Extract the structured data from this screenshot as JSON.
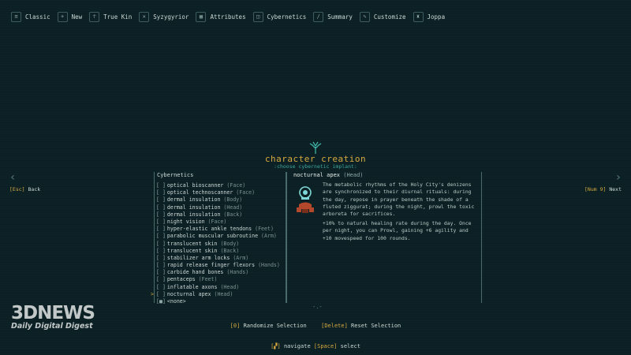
{
  "topbar": {
    "tabs": [
      {
        "label": "Classic",
        "icon": "scroll-icon"
      },
      {
        "label": "New",
        "icon": "plus-icon"
      },
      {
        "label": "True Kin",
        "icon": "person-icon"
      },
      {
        "label": "Syzygyrior",
        "icon": "crossed-swords-icon"
      },
      {
        "label": "Attributes",
        "icon": "attributes-icon"
      },
      {
        "label": "Cybernetics",
        "icon": "chip-icon"
      },
      {
        "label": "Summary",
        "icon": "page-icon"
      },
      {
        "label": "Customize",
        "icon": "pen-icon"
      },
      {
        "label": "Joppa",
        "icon": "walker-icon"
      }
    ]
  },
  "header": {
    "title": "character creation",
    "subtitle": ":choose cybernetic implant:"
  },
  "nav": {
    "back_key": "[Esc]",
    "back_label": "Back",
    "next_key": "[Num 9]",
    "next_label": "Next"
  },
  "list": {
    "title": "Cybernetics",
    "items": [
      {
        "checkbox": "[ ]",
        "name": "optical bioscanner",
        "slot": "(Face)"
      },
      {
        "checkbox": "[ ]",
        "name": "optical technoscanner",
        "slot": "(Face)"
      },
      {
        "checkbox": "[ ]",
        "name": "dermal insulation",
        "slot": "(Body)"
      },
      {
        "checkbox": "[ ]",
        "name": "dermal insulation",
        "slot": "(Head)"
      },
      {
        "checkbox": "[ ]",
        "name": "dermal insulation",
        "slot": "(Back)"
      },
      {
        "checkbox": "[ ]",
        "name": "night vision",
        "slot": "(Face)"
      },
      {
        "checkbox": "[ ]",
        "name": "hyper-elastic ankle tendons",
        "slot": "(Feet)"
      },
      {
        "checkbox": "[ ]",
        "name": "parabolic muscular subroutine",
        "slot": "(Arm)"
      },
      {
        "checkbox": "[ ]",
        "name": "translucent skin",
        "slot": "(Body)"
      },
      {
        "checkbox": "[ ]",
        "name": "translucent skin",
        "slot": "(Back)"
      },
      {
        "checkbox": "[ ]",
        "name": "stabilizer arm locks",
        "slot": "(Arm)"
      },
      {
        "checkbox": "[ ]",
        "name": "rapid release finger flexors",
        "slot": "(Hands)"
      },
      {
        "checkbox": "[ ]",
        "name": "carbide hand bones",
        "slot": "(Hands)"
      },
      {
        "checkbox": "[ ]",
        "name": "pentaceps",
        "slot": "(Feet)"
      },
      {
        "checkbox": "[ ]",
        "name": "inflatable axons",
        "slot": "(Head)"
      },
      {
        "checkbox": "[ ]",
        "name": "nocturnal apex",
        "slot": "(Head)",
        "caret": ">"
      },
      {
        "checkbox": "[■]",
        "name": "<none>",
        "slot": ""
      }
    ]
  },
  "detail": {
    "name": "nocturnal apex",
    "slot": "(Head)",
    "description": "The metabolic rhythms of the Holy City's denizens are synchronized to their diurnal rituals: during the day, repose in prayer beneath the shade of a fluted ziggurat; during the night, prowl the toxic arboreta for sacrifices.",
    "effect": "+10% to natural healing rate during the day. Once per night, you can Prowl, gaining +6 agility and +10 movespeed for 100 rounds.",
    "more_indicator": "-.-"
  },
  "actions": {
    "randomize_key": "[0]",
    "randomize_label": "Randomize Selection",
    "reset_key": "[Delete]",
    "reset_label": "Reset Selection"
  },
  "footer": {
    "navigate_label": "navigate",
    "select_key": "[Space]",
    "select_label": "select"
  },
  "watermark": {
    "brand": "3DNEWS",
    "tagline": "Daily Digital Digest"
  },
  "colors": {
    "background": "#0c2226",
    "title": "#d8a941",
    "accent": "#3fa7a0",
    "text": "#cdd8d6"
  }
}
